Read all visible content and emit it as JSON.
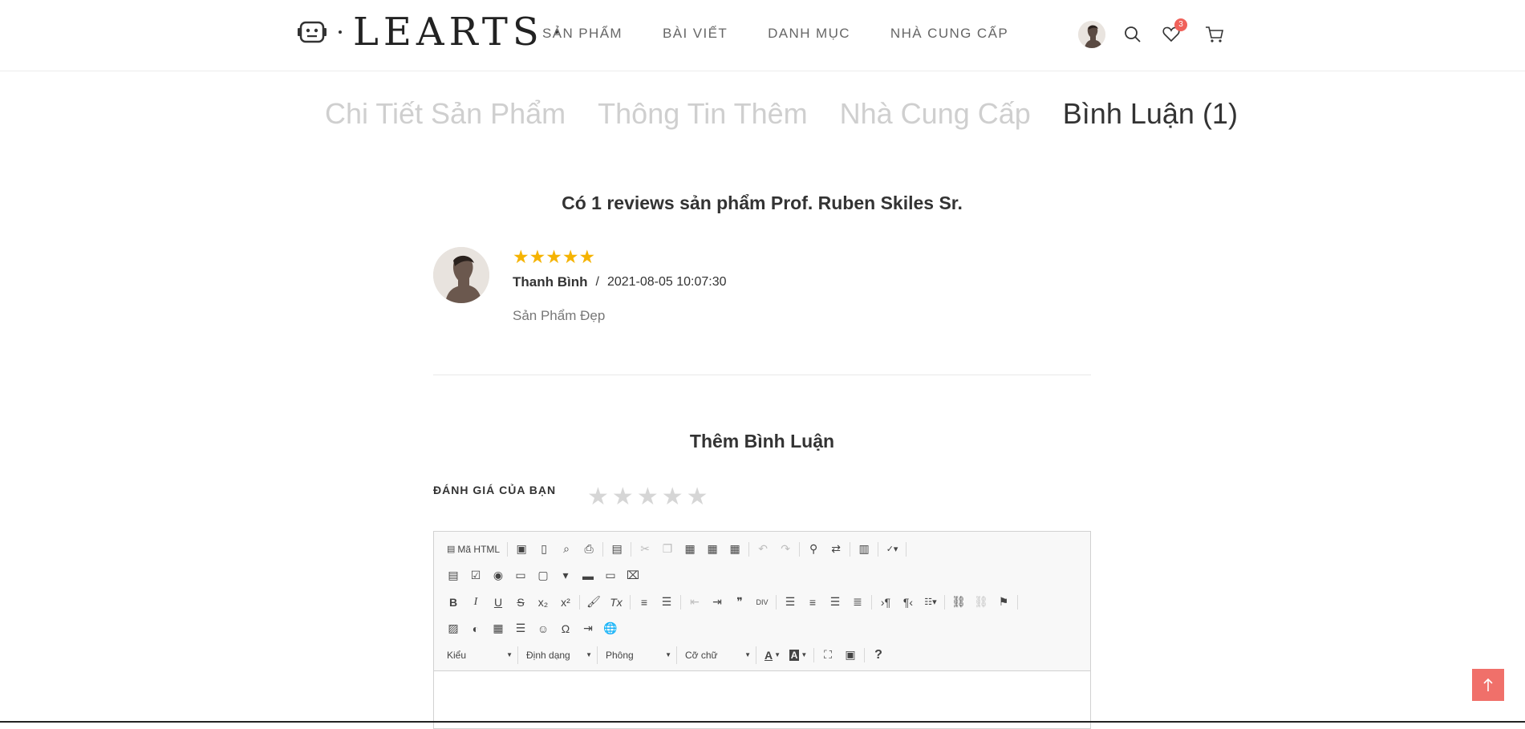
{
  "header": {
    "logo_text": "LEARTS",
    "nav": [
      "SẢN PHẨM",
      "BÀI VIẾT",
      "DANH MỤC",
      "NHÀ CUNG CẤP"
    ],
    "wishlist_count": "3",
    "icons": [
      "user-avatar",
      "search-icon",
      "heart-icon",
      "cart-icon"
    ]
  },
  "tabs": [
    {
      "label": "Chi Tiết Sản Phẩm",
      "active": false
    },
    {
      "label": "Thông Tin Thêm",
      "active": false
    },
    {
      "label": "Nhà Cung Cấp",
      "active": false
    },
    {
      "label": "Bình Luận (1)",
      "active": true
    }
  ],
  "reviews": {
    "title": "Có 1 reviews sản phẩm Prof. Ruben Skiles Sr.",
    "items": [
      {
        "rating": 5,
        "author": "Thanh Bình",
        "separator": "/",
        "date": "2021-08-05 10:07:30",
        "text": "Sản Phẩm Đẹp"
      }
    ]
  },
  "add_comment": {
    "title": "Thêm Bình Luận",
    "rating_label": "ĐÁNH GIÁ CỦA BẠN",
    "rating_value": 0,
    "rating_max": 5
  },
  "editor": {
    "source_label": "Mã HTML",
    "combos": [
      "Kiểu",
      "Định dạng",
      "Phông",
      "Cỡ chữ"
    ],
    "help_label": "?"
  },
  "colors": {
    "accent": "#f0706a",
    "star": "#f5b301",
    "star_empty": "#d6d6d6",
    "tab_inactive": "#cfcfcf",
    "text": "#333333"
  }
}
